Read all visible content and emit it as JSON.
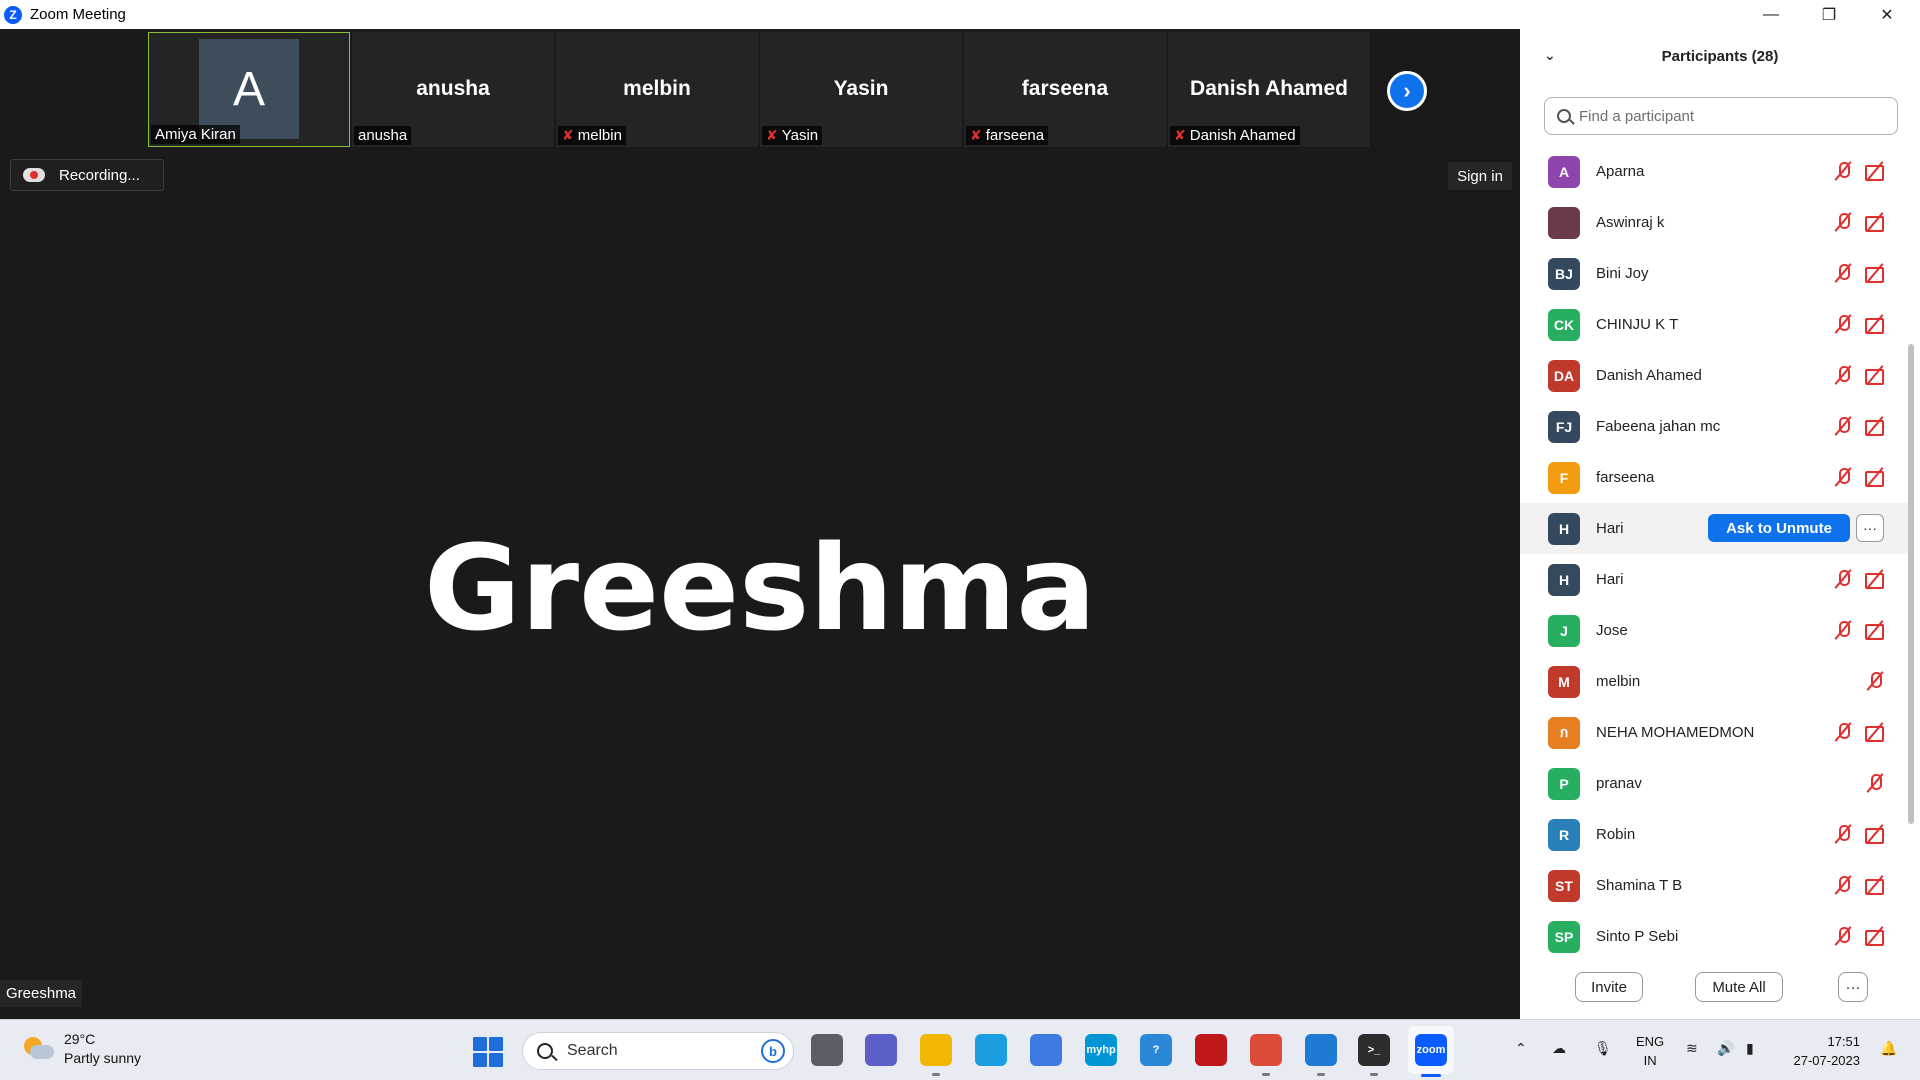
{
  "window": {
    "title": "Zoom Meeting",
    "app_icon": "Z"
  },
  "video_strip": [
    {
      "display": "A",
      "name": "Amiya Kiran",
      "muted": false,
      "active": true
    },
    {
      "display": "anusha",
      "name": "anusha",
      "muted": false,
      "active": false
    },
    {
      "display": "melbin",
      "name": "melbin",
      "muted": true,
      "active": false
    },
    {
      "display": "Yasin",
      "name": "Yasin",
      "muted": true,
      "active": false
    },
    {
      "display": "farseena",
      "name": "farseena",
      "muted": true,
      "active": false
    },
    {
      "display": "Danish Ahamed",
      "name": "Danish Ahamed",
      "muted": true,
      "active": false
    }
  ],
  "recording": {
    "label": "Recording..."
  },
  "signin": {
    "label": "Sign in"
  },
  "speaker": {
    "big_name": "Greeshma",
    "tag": "Greeshma"
  },
  "panel": {
    "title": "Participants (28)",
    "search_placeholder": "Find a participant",
    "participants": [
      {
        "initials": "A",
        "name": "Aparna",
        "color": "#8e44ad",
        "mic_off": true,
        "cam_off": true
      },
      {
        "initials": "",
        "name": "Aswinraj k",
        "color": "#6b3a4a",
        "mic_off": true,
        "cam_off": true
      },
      {
        "initials": "BJ",
        "name": "Bini Joy",
        "color": "#34495e",
        "mic_off": true,
        "cam_off": true
      },
      {
        "initials": "CK",
        "name": "CHINJU K T",
        "color": "#27ae60",
        "mic_off": true,
        "cam_off": true
      },
      {
        "initials": "DA",
        "name": "Danish Ahamed",
        "color": "#c0392b",
        "mic_off": true,
        "cam_off": true
      },
      {
        "initials": "FJ",
        "name": "Fabeena jahan mc",
        "color": "#34495e",
        "mic_off": true,
        "cam_off": true
      },
      {
        "initials": "F",
        "name": "farseena",
        "color": "#f39c12",
        "mic_off": true,
        "cam_off": true
      },
      {
        "initials": "H",
        "name": "Hari",
        "color": "#34495e",
        "mic_off": false,
        "cam_off": false,
        "hover": true
      },
      {
        "initials": "H",
        "name": "Hari",
        "color": "#34495e",
        "mic_off": true,
        "cam_off": true
      },
      {
        "initials": "J",
        "name": "Jose",
        "color": "#27ae60",
        "mic_off": true,
        "cam_off": true
      },
      {
        "initials": "M",
        "name": "melbin",
        "color": "#c0392b",
        "mic_off": true,
        "cam_off": false
      },
      {
        "initials": "ก",
        "name": "NEHA MOHAMEDMON",
        "color": "#e67e22",
        "mic_off": true,
        "cam_off": true
      },
      {
        "initials": "P",
        "name": "pranav",
        "color": "#27ae60",
        "mic_off": true,
        "cam_off": false
      },
      {
        "initials": "R",
        "name": "Robin",
        "color": "#2980b9",
        "mic_off": true,
        "cam_off": true
      },
      {
        "initials": "ST",
        "name": "Shamina T  B",
        "color": "#c0392b",
        "mic_off": true,
        "cam_off": true
      },
      {
        "initials": "SP",
        "name": "Sinto P Sebi",
        "color": "#27ae60",
        "mic_off": true,
        "cam_off": true
      }
    ],
    "ask_unmute_label": "Ask to Unmute",
    "more_label": "···",
    "footer": {
      "invite": "Invite",
      "mute_all": "Mute All",
      "more": "···"
    }
  },
  "taskbar": {
    "weather": {
      "temp": "29°C",
      "desc": "Partly sunny"
    },
    "search_label": "Search",
    "bing_label": "b",
    "apps": [
      {
        "name": "task-view",
        "label": "",
        "color": "#5a5f66"
      },
      {
        "name": "teams-meet",
        "label": "",
        "color": "#5b5fc7"
      },
      {
        "name": "file-explorer",
        "label": "",
        "color": "#f2b705"
      },
      {
        "name": "edge",
        "label": "",
        "color": "#1b9de2"
      },
      {
        "name": "ms-store",
        "label": "",
        "color": "#3d7be0"
      },
      {
        "name": "myhp",
        "label": "myhp",
        "color": "#0096d6"
      },
      {
        "name": "get-help",
        "label": "?",
        "color": "#2b88d8"
      },
      {
        "name": "mcafee",
        "label": "",
        "color": "#c01818"
      },
      {
        "name": "chrome",
        "label": "",
        "color": "#dd4b39"
      },
      {
        "name": "vscode",
        "label": "",
        "color": "#1f7ad4"
      },
      {
        "name": "terminal",
        "label": ">_",
        "color": "#2d2d2d"
      },
      {
        "name": "zoom",
        "label": "zoom",
        "color": "#0b5cff"
      }
    ],
    "lang": {
      "line1": "ENG",
      "line2": "IN"
    },
    "clock": {
      "time": "17:51",
      "date": "27-07-2023"
    }
  }
}
